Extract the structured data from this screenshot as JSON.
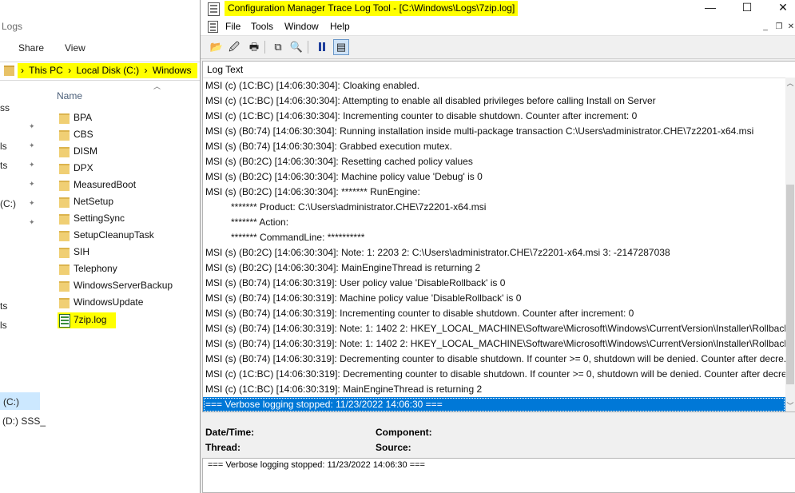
{
  "explorer": {
    "title_fragment": "Logs",
    "ribbon": [
      "Share",
      "View"
    ],
    "breadcrumbs": [
      "This PC",
      "Local Disk (C:)",
      "Windows"
    ],
    "column_header": "Name",
    "nav_fragments": [
      "ss",
      "ls",
      "ts",
      "(C:)",
      "ts",
      "ls",
      "(C:)",
      "(D:) SSS_"
    ],
    "files": [
      "BPA",
      "CBS",
      "DISM",
      "DPX",
      "MeasuredBoot",
      "NetSetup",
      "SettingSync",
      "SetupCleanupTask",
      "SIH",
      "Telephony",
      "WindowsServerBackup",
      "WindowsUpdate",
      "7zip.log"
    ]
  },
  "cmtrace": {
    "title": "Configuration Manager Trace Log Tool - [C:\\Windows\\Logs\\7zip.log]",
    "menu": [
      "File",
      "Tools",
      "Window",
      "Help"
    ],
    "window_controls": {
      "minimize": "—",
      "maximize": "☐",
      "close": "✕"
    },
    "mdi_controls": {
      "minimize": "_",
      "restore": "❐",
      "close": "✕"
    },
    "toolbar_icons": [
      "open-icon",
      "refresh-icon",
      "print-icon",
      "copy-icon",
      "find-icon",
      "pause-icon",
      "highlight-icon"
    ],
    "log_header": "Log Text",
    "lines": [
      "MSI (c) (1C:BC) [14:06:30:304]: Cloaking enabled.",
      "MSI (c) (1C:BC) [14:06:30:304]: Attempting to enable all disabled privileges before calling Install on Server",
      "MSI (c) (1C:BC) [14:06:30:304]: Incrementing counter to disable shutdown. Counter after increment: 0",
      "MSI (s) (B0:74) [14:06:30:304]: Running installation inside multi-package transaction C:\\Users\\administrator.CHE\\7z2201-x64.msi",
      "MSI (s) (B0:74) [14:06:30:304]: Grabbed execution mutex.",
      "MSI (s) (B0:2C) [14:06:30:304]: Resetting cached policy values",
      "MSI (s) (B0:2C) [14:06:30:304]: Machine policy value 'Debug' is 0",
      "MSI (s) (B0:2C) [14:06:30:304]: ******* RunEngine:",
      "******* Product: C:\\Users\\administrator.CHE\\7z2201-x64.msi",
      "******* Action:",
      "******* CommandLine: **********",
      "MSI (s) (B0:2C) [14:06:30:304]: Note: 1: 2203 2: C:\\Users\\administrator.CHE\\7z2201-x64.msi 3: -2147287038",
      "MSI (s) (B0:2C) [14:06:30:304]: MainEngineThread is returning 2",
      "MSI (s) (B0:74) [14:06:30:319]: User policy value 'DisableRollback' is 0",
      "MSI (s) (B0:74) [14:06:30:319]: Machine policy value 'DisableRollback' is 0",
      "MSI (s) (B0:74) [14:06:30:319]: Incrementing counter to disable shutdown. Counter after increment: 0",
      "MSI (s) (B0:74) [14:06:30:319]: Note: 1: 1402 2: HKEY_LOCAL_MACHINE\\Software\\Microsoft\\Windows\\CurrentVersion\\Installer\\Rollback\\...",
      "MSI (s) (B0:74) [14:06:30:319]: Note: 1: 1402 2: HKEY_LOCAL_MACHINE\\Software\\Microsoft\\Windows\\CurrentVersion\\Installer\\Rollback\\...",
      "MSI (s) (B0:74) [14:06:30:319]: Decrementing counter to disable shutdown. If counter >= 0, shutdown will be denied.  Counter after decre...",
      "MSI (c) (1C:BC) [14:06:30:319]: Decrementing counter to disable shutdown. If counter >= 0, shutdown will be denied.  Counter after decre...",
      "MSI (c) (1C:BC) [14:06:30:319]: MainEngineThread is returning 2",
      "=== Verbose logging stopped: 11/23/2022  14:06:30 ==="
    ],
    "selected_index": 21,
    "details": {
      "datetime_label": "Date/Time:",
      "component_label": "Component:",
      "thread_label": "Thread:",
      "source_label": "Source:",
      "text": "=== Verbose logging stopped: 11/23/2022  14:06:30 ==="
    }
  }
}
